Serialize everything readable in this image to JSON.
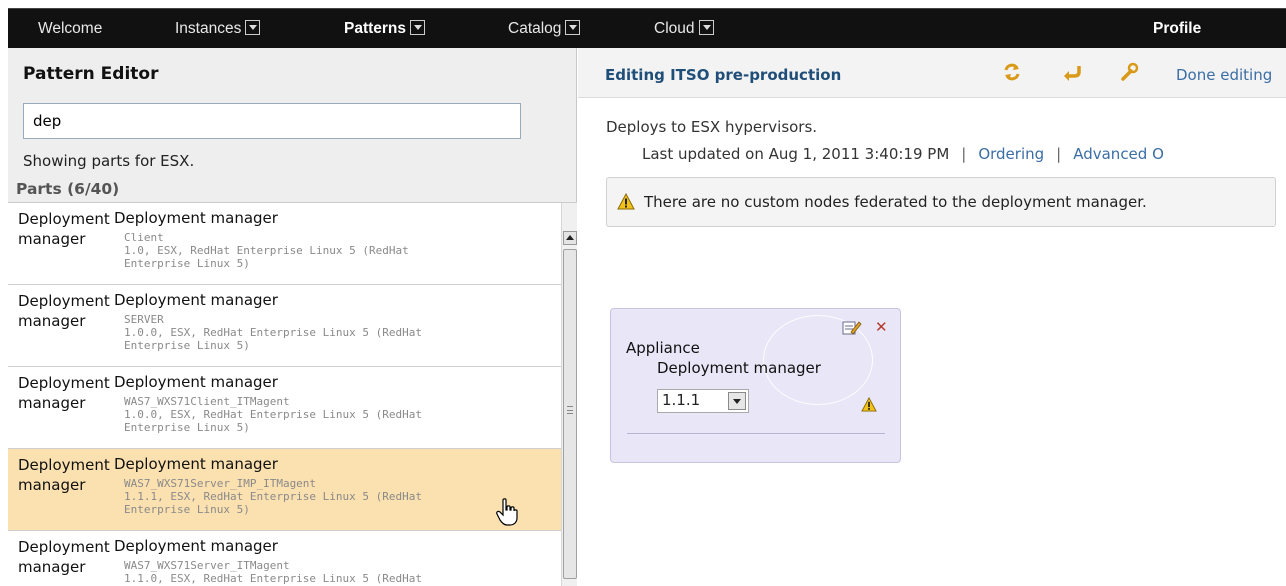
{
  "nav": {
    "items": [
      {
        "label": "Welcome",
        "dropdown": false
      },
      {
        "label": "Instances",
        "dropdown": true
      },
      {
        "label": "Patterns",
        "dropdown": true
      },
      {
        "label": "Catalog",
        "dropdown": true
      },
      {
        "label": "Cloud",
        "dropdown": true
      }
    ],
    "active": "Patterns",
    "profile_label": "Profile"
  },
  "left": {
    "title": "Pattern Editor",
    "search_value": "dep",
    "showing_text": "Showing parts for ESX.",
    "parts_header": "Parts (6/40)",
    "parts": [
      {
        "name": "Deployment manager",
        "title": "Deployment manager",
        "variant": "Client",
        "details": "1.0, ESX, RedHat Enterprise Linux 5 (RedHat\nEnterprise Linux 5)",
        "selected": false
      },
      {
        "name": "Deployment manager",
        "title": "Deployment manager",
        "variant": "SERVER",
        "details": "1.0.0, ESX, RedHat Enterprise Linux 5 (RedHat\nEnterprise Linux 5)",
        "selected": false
      },
      {
        "name": "Deployment manager",
        "title": "Deployment manager",
        "variant": "WAS7_WXS71Client_ITMagent",
        "details": "1.0.0, ESX, RedHat Enterprise Linux 5 (RedHat\nEnterprise Linux 5)",
        "selected": false
      },
      {
        "name": "Deployment manager",
        "title": "Deployment manager",
        "variant": "WAS7_WXS71Server_IMP_ITMagent",
        "details": "1.1.1, ESX, RedHat Enterprise Linux 5 (RedHat\nEnterprise Linux 5)",
        "selected": true
      },
      {
        "name": "Deployment manager",
        "title": "Deployment manager",
        "variant": "WAS7_WXS71Server_ITMagent",
        "details": "1.1.0, ESX, RedHat Enterprise Linux 5 (RedHat",
        "selected": false
      }
    ]
  },
  "right": {
    "editing_title": "Editing ITSO pre-production",
    "done_label": "Done editing",
    "description": "Deploys to ESX hypervisors.",
    "last_updated": "Last updated on Aug 1, 2011 3:40:19 PM",
    "ordering_link": "Ordering",
    "advanced_link": "Advanced O",
    "warning_text": "There are no custom nodes federated to the deployment manager.",
    "node": {
      "label": "Appliance",
      "component": "Deployment manager",
      "version_selected": "1.1.1"
    }
  },
  "colors": {
    "nav_bg": "#111111",
    "selected_row": "#fbe0b0",
    "node_bg": "#e9e6f7",
    "link": "#3a6ea5",
    "title_blue": "#1f4e79"
  }
}
